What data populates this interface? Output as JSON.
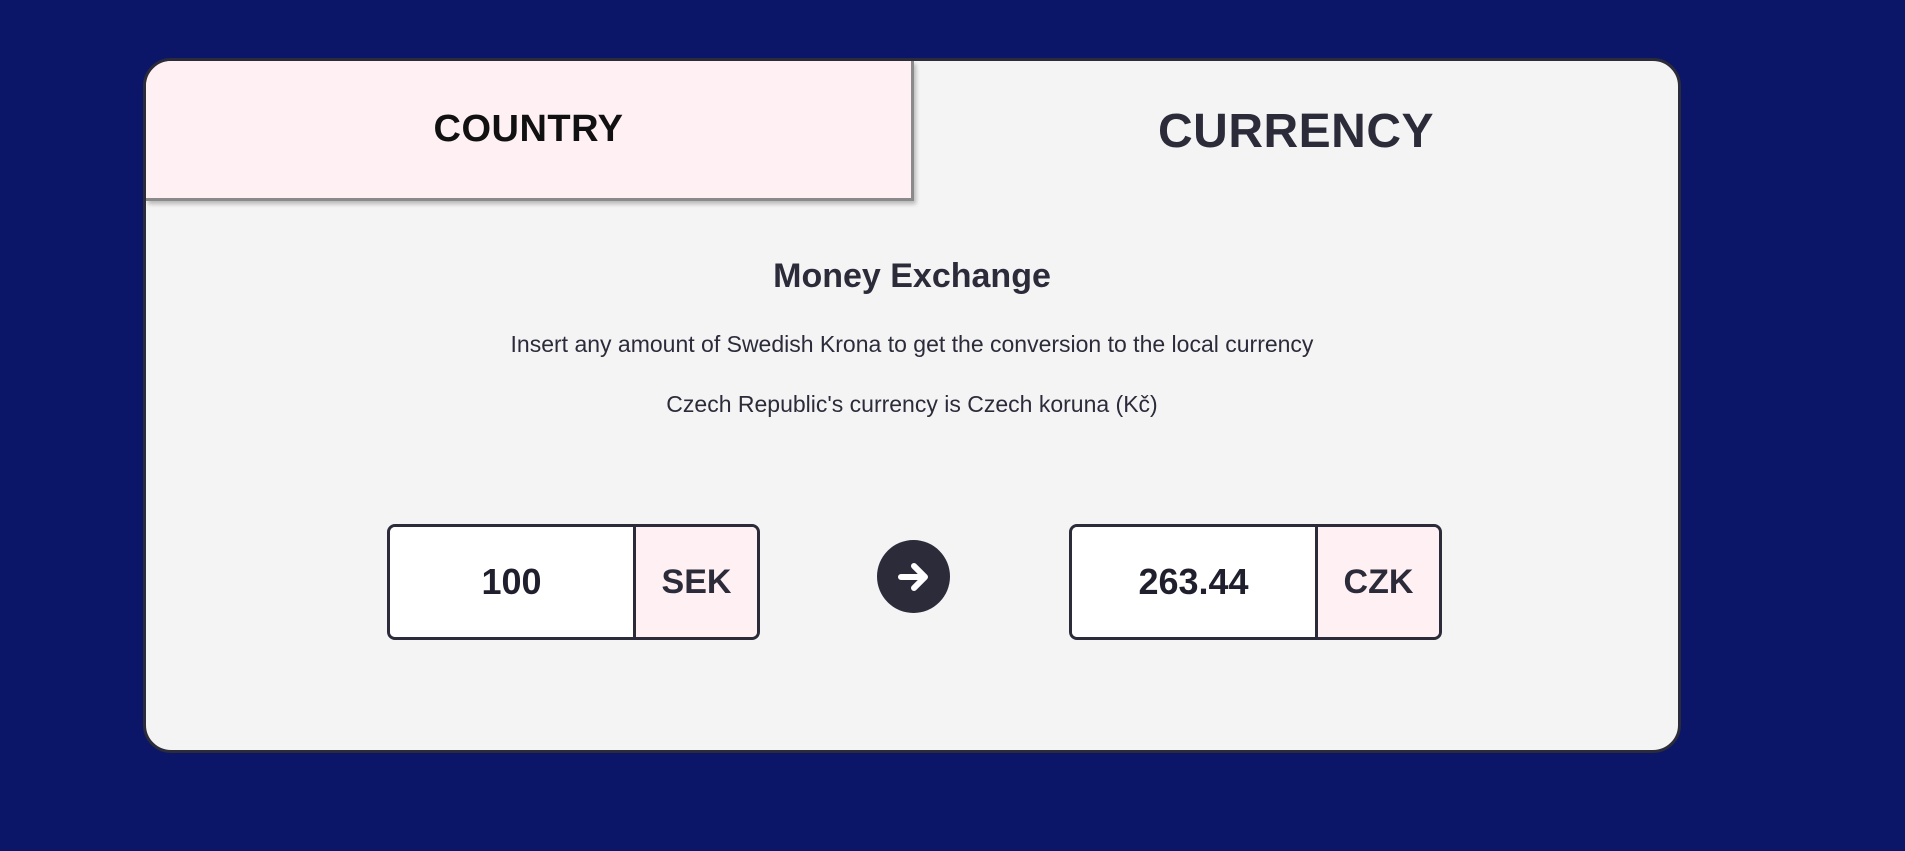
{
  "tabs": {
    "country_label": "COUNTRY",
    "currency_label": "CURRENCY"
  },
  "exchange": {
    "title": "Money Exchange",
    "description": "Insert any amount of Swedish Krona to get the conversion to the local currency",
    "currency_info": "Czech Republic's currency is Czech koruna (Kč)"
  },
  "converter": {
    "from_amount": "100",
    "from_code": "SEK",
    "to_amount": "263.44",
    "to_code": "CZK",
    "convert_icon": "arrow-right-circle-icon"
  },
  "colors": {
    "background": "#0b1668",
    "card": "#f4f4f4",
    "tab_active": "#fff0f3",
    "text_dark": "#2b2b3a"
  }
}
